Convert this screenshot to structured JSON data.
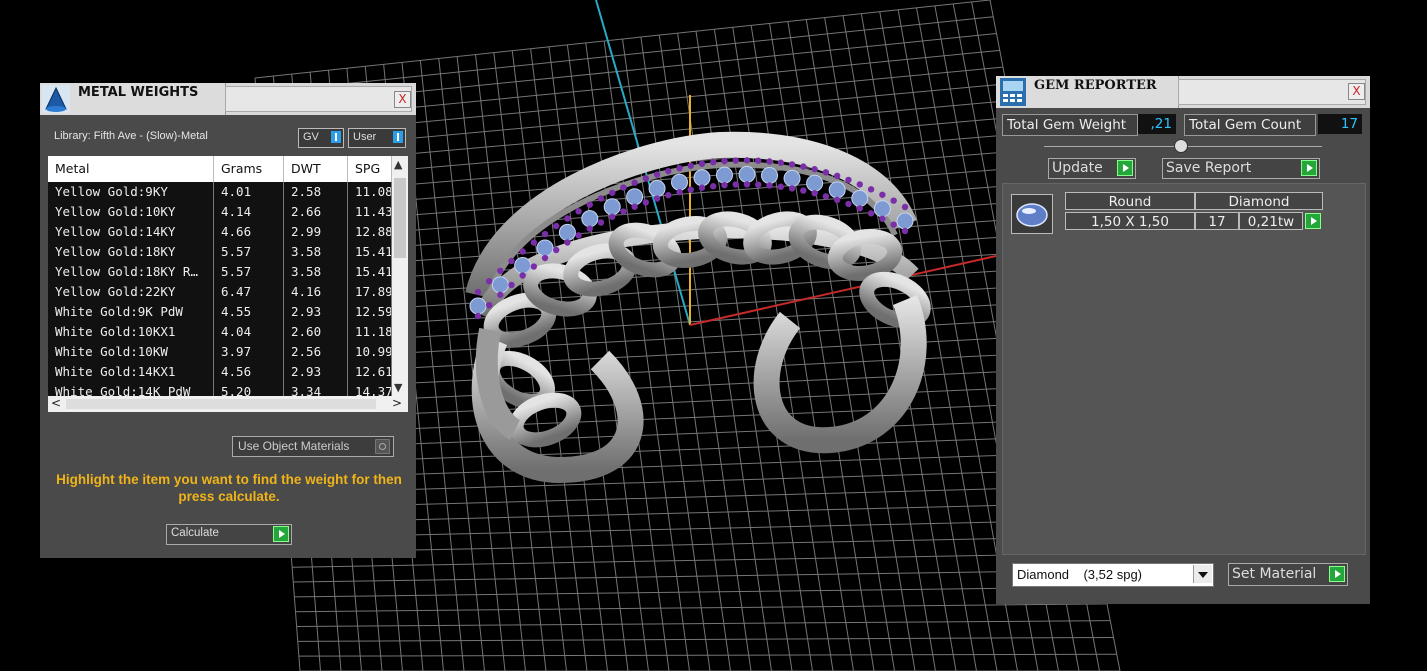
{
  "metal_weights": {
    "title": "METAL WEIGHTS",
    "close_glyph": "X",
    "library_label": "Library: Fifth Ave - (Slow)-Metal",
    "toggle_gv": "GV",
    "toggle_user": "User",
    "columns": [
      "Metal",
      "Grams",
      "DWT",
      "SPG"
    ],
    "rows": [
      [
        "Yellow Gold:9KY",
        "4.01",
        "2.58",
        "11.08"
      ],
      [
        "Yellow Gold:10KY",
        "4.14",
        "2.66",
        "11.43"
      ],
      [
        "Yellow Gold:14KY",
        "4.66",
        "2.99",
        "12.88"
      ],
      [
        "Yellow Gold:18KY",
        "5.57",
        "3.58",
        "15.41"
      ],
      [
        "Yellow Gold:18KY R…",
        "5.57",
        "3.58",
        "15.41"
      ],
      [
        "Yellow Gold:22KY",
        "6.47",
        "4.16",
        "17.89"
      ],
      [
        "White Gold:9K PdW",
        "4.55",
        "2.93",
        "12.59"
      ],
      [
        "White Gold:10KX1",
        "4.04",
        "2.60",
        "11.18"
      ],
      [
        "White Gold:10KW",
        "3.97",
        "2.56",
        "10.99"
      ],
      [
        "White Gold:14KX1",
        "4.56",
        "2.93",
        "12.61"
      ],
      [
        "White Gold:14K PdW",
        "5.20",
        "3.34",
        "14.37"
      ]
    ],
    "use_object_materials": "Use Object Materials",
    "hint": "Highlight the item you want to find the weight for then press calculate.",
    "calculate_label": "Calculate"
  },
  "gem_reporter": {
    "title": "GEM REPORTER",
    "close_glyph": "X",
    "total_weight_label": "Total Gem Weight",
    "total_weight_value": ",21",
    "total_count_label": "Total Gem Count",
    "total_count_value": "17",
    "update_label": "Update",
    "save_report_label": "Save Report",
    "gem_entry": {
      "shape": "Round",
      "type": "Diamond",
      "size": "1,50 X 1,50",
      "count": "17",
      "weight": "0,21tw"
    },
    "material_select": "Diamond    (3,52 spg)",
    "set_material_label": "Set Material"
  },
  "colors": {
    "background": "#000000",
    "panel": "#4a4a4a",
    "hint_text": "#f0b419",
    "value_text": "#2ec3ff",
    "play_button": "#23a63a",
    "gem_purple": "#7a2fa8",
    "gem_blue": "#7d9ad2",
    "metal": "#b8b8b8"
  }
}
